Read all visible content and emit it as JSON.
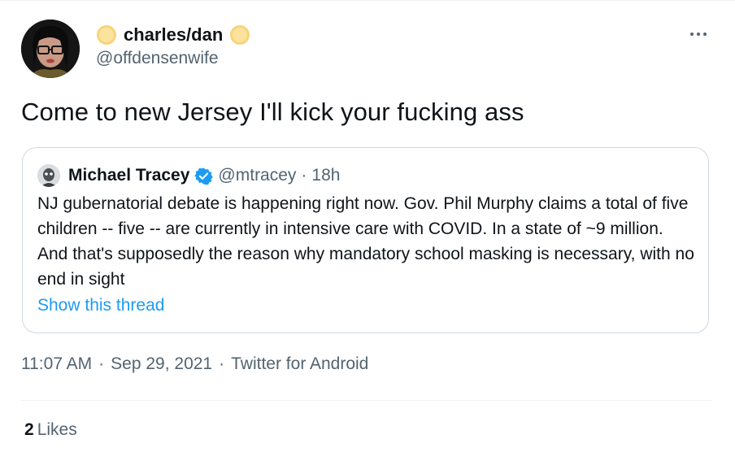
{
  "tweet": {
    "display_name": "charles/dan",
    "handle": "@offdensenwife",
    "text": "Come to new Jersey I'll kick your fucking ass",
    "timestamp_time": "11:07 AM",
    "timestamp_date": "Sep 29, 2021",
    "source": "Twitter for Android",
    "separator": "·",
    "likes_count": "2",
    "likes_label": "Likes",
    "emoji_icon": "yellow-circle-emoji"
  },
  "quoted": {
    "display_name": "Michael Tracey",
    "handle": "@mtracey",
    "separator": "·",
    "time": "18h",
    "text": "NJ gubernatorial debate is happening right now. Gov. Phil Murphy claims a total of five children -- five -- are currently in intensive care with COVID. In a state of ~9 million. And that's supposedly the reason why mandatory school masking is necessary, with no end in sight",
    "show_thread": "Show this thread"
  },
  "colors": {
    "accent": "#1d9bf0",
    "secondary_text": "#536471",
    "border": "#cfd9de"
  }
}
